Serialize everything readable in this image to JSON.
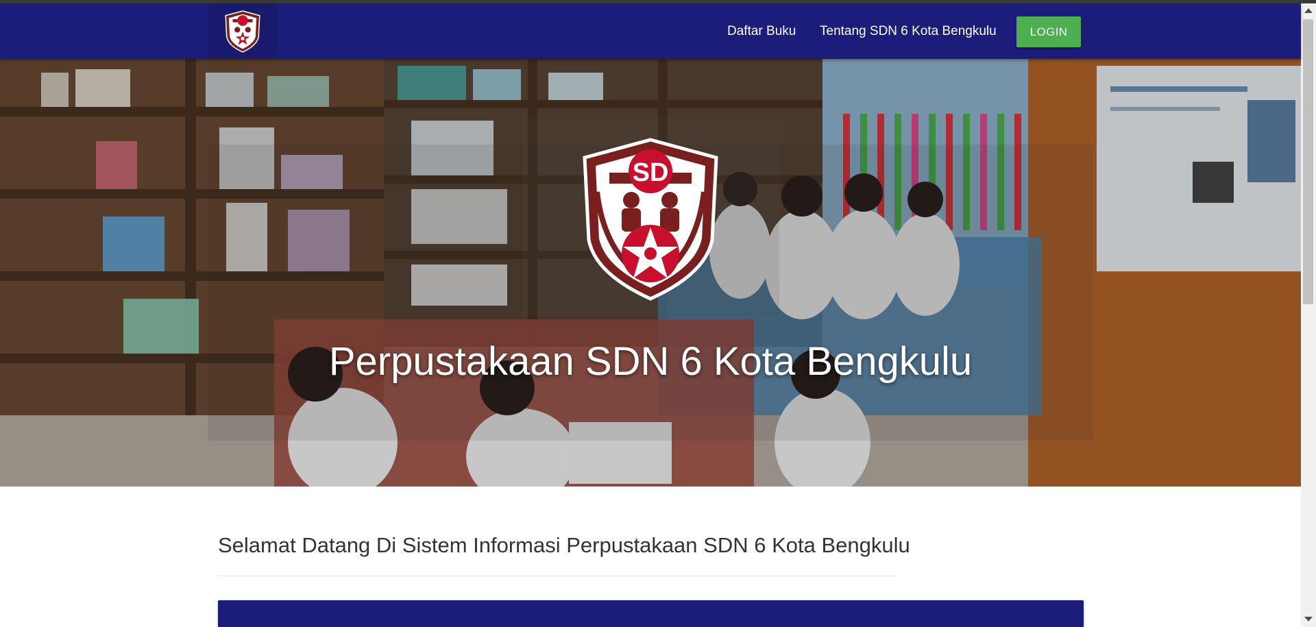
{
  "nav": {
    "links": [
      {
        "label": "Daftar Buku"
      },
      {
        "label": "Tentang SDN 6 Kota Bengkulu"
      }
    ],
    "login_label": "LOGIN",
    "brand_icon": "sd-school-emblem-icon"
  },
  "hero": {
    "title": "Perpustakaan SDN 6 Kota Bengkulu",
    "emblem_text": "SD",
    "emblem_icon": "sd-school-emblem-icon"
  },
  "main": {
    "welcome": "Selamat Datang Di Sistem Informasi Perpustakaan SDN 6 Kota Bengkulu"
  },
  "colors": {
    "navbar": "#1c1c7a",
    "login_button": "#4caf50",
    "emblem_red": "#c8102e",
    "emblem_dark": "#7a1f1f"
  }
}
